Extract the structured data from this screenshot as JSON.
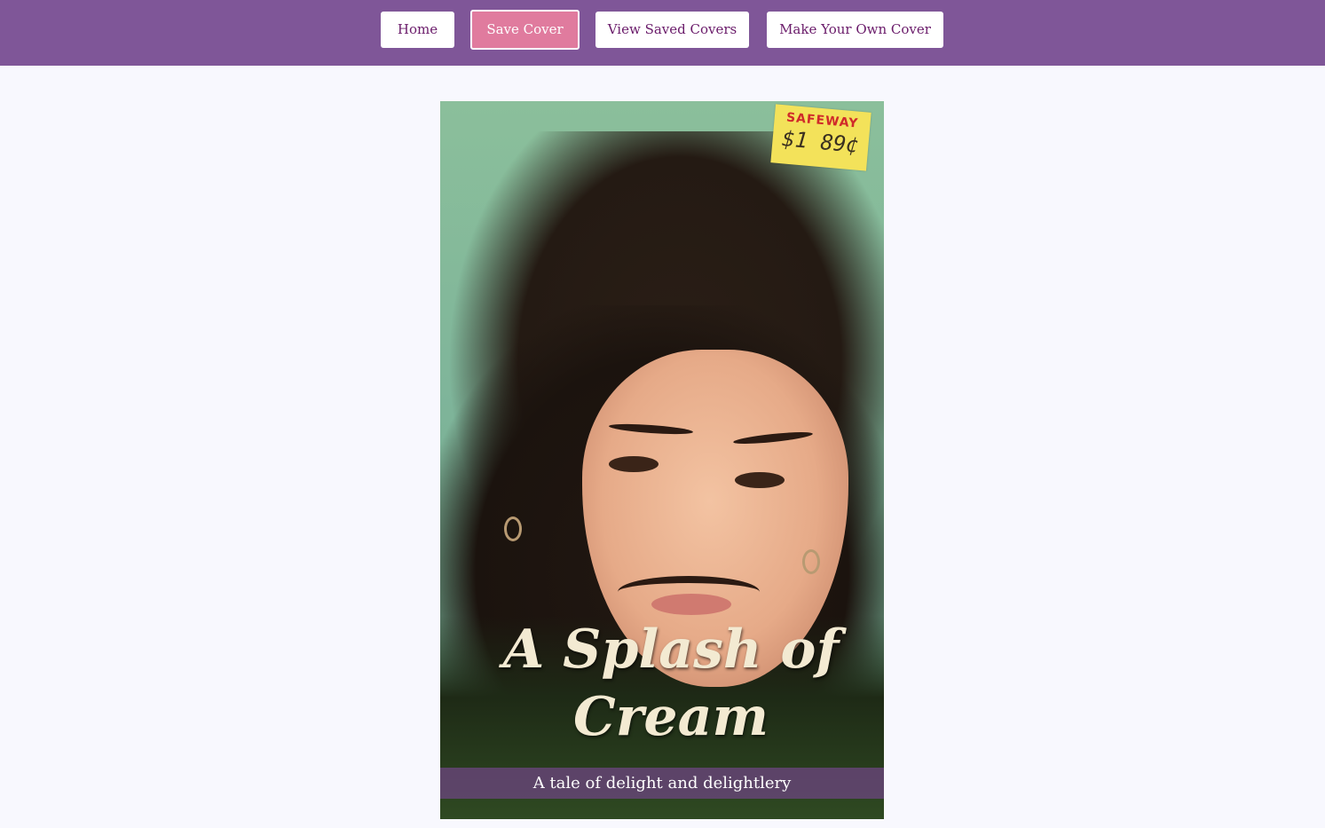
{
  "nav": {
    "home_label": "Home",
    "save_label": "Save Cover",
    "view_saved_label": "View Saved Covers",
    "make_own_label": "Make Your Own Cover"
  },
  "cover": {
    "title": "A Splash of Cream",
    "tagline": "A tale of delight and delightlery",
    "price_tag": {
      "store": "SAFEWAY",
      "price": "$1 89¢"
    }
  },
  "colors": {
    "header": "#7f5698",
    "active_button": "#e07b9e",
    "button_text": "#6a1b6a",
    "page_background": "#f8f8fe",
    "title_text": "#f3ead2"
  }
}
